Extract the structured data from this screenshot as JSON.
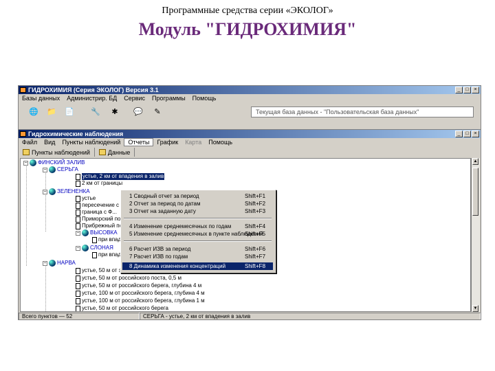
{
  "slide": {
    "caption": "Программные средства серии «ЭКОЛОГ»",
    "heading": "Модуль \"ГИДРОХИМИЯ\""
  },
  "app": {
    "title": "ГИДРОХИМИЯ (Серия ЭКОЛОГ) Версия 3.1",
    "menu": [
      "Базы данных",
      "Администрир. БД",
      "Сервис",
      "Программы",
      "Помощь"
    ],
    "db_label": "Текущая база данных - \"Пользовательская база данных\""
  },
  "window": {
    "title": "Гидрохимические наблюдения",
    "menu": [
      "Файл",
      "Вид",
      "Пункты наблюдений",
      "Отчеты",
      "График",
      "Карта",
      "Помощь"
    ],
    "toolbar": [
      "Пункты наблюдений",
      "Данные"
    ]
  },
  "report_menu": {
    "items": [
      {
        "label": "1  Сводный отчет за период",
        "key": "Shift+F1"
      },
      {
        "label": "2  Отчет за период по датам",
        "key": "Shift+F2"
      },
      {
        "label": "3  Отчет на заданную дату",
        "key": "Shift+F3"
      },
      {
        "label": "4  Изменение среднемесячных по годам",
        "key": "Shift+F4"
      },
      {
        "label": "5  Изменение среднемесячных в пункте наблюдений",
        "key": "Shift+F5"
      },
      {
        "label": "6  Расчет ИЗВ за период",
        "key": "Shift+F6"
      },
      {
        "label": "7  Расчет ИЗВ по годам",
        "key": "Shift+F7"
      },
      {
        "label": "8  Динамика изменения концентраций",
        "key": "Shift+F8"
      }
    ],
    "highlighted": 7
  },
  "tree": {
    "root": "ФИНСКИЙ ЗАЛИВ",
    "n1": "СЕРЬГА",
    "n1a": "устье, 2 км от впадения в залив",
    "n1b": "2 км от границы",
    "n2": "ЗЕЛЕНЕНКА",
    "n2a": "устье",
    "n2b": "пересечение с ...",
    "n2c": "граница с Ф...",
    "n2d": "Приморский пост",
    "n2e": "Прибрежный пост",
    "n3": "ВЫСОВКА",
    "n3a": "при впадении в р.Зелененка",
    "n4": "СЛОНАЯ",
    "n4a": "при впадении в р.Солоновская, устье",
    "n5": "НАРВА",
    "n5a": "устье, 50 м от эстонского берега, 0,5 м",
    "n5b": "устье, 50 м от российского поста, 0,5 м",
    "n5c": "устье, 50 м от российского берега, глубина 4 м",
    "n5d": "устье, 100 м от российского берега, глубина 4 м",
    "n5e": "устье, 100 м от российского берега, глубина 1 м",
    "n5f": "устье, 50 м от российского берега"
  },
  "status": {
    "count": "Всего пунктов — 52",
    "selected": "СЕРЬГА - устье, 2 км от впадения в залив"
  },
  "colors": {
    "title_blue": "#0a246a",
    "heading_purple": "#6a2a7a",
    "chrome": "#d4d0c8"
  }
}
